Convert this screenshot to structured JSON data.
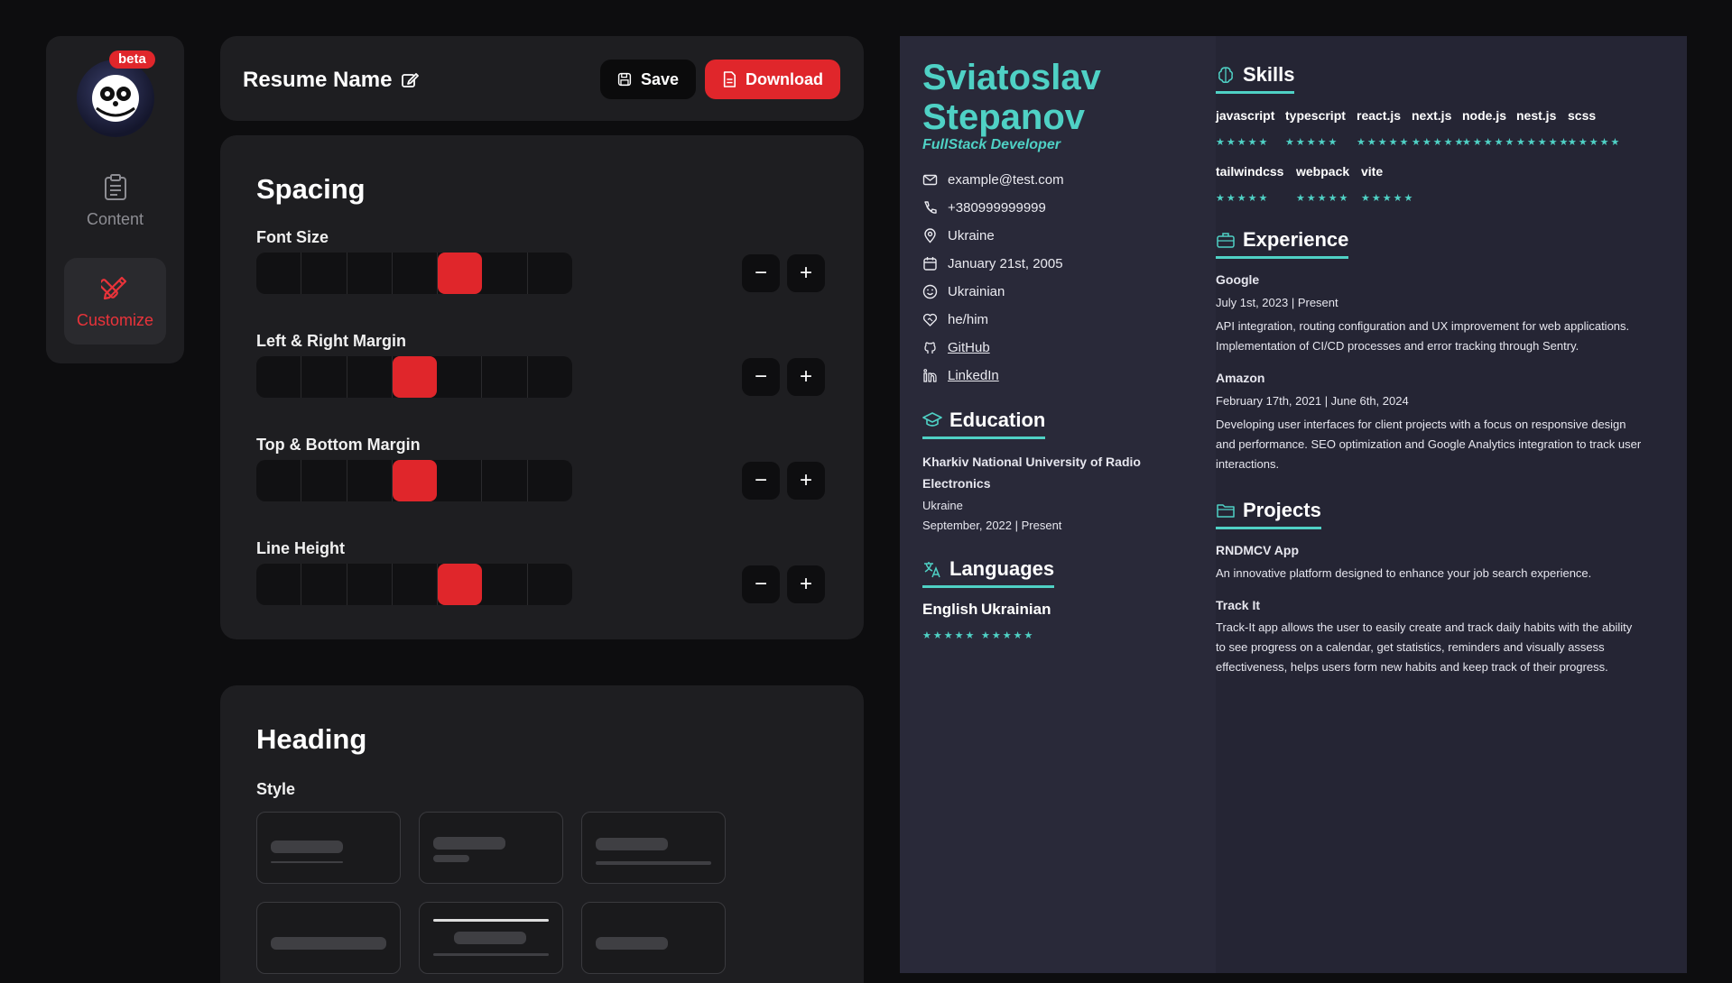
{
  "sidebar": {
    "beta": "beta",
    "items": [
      {
        "label": "Content",
        "icon": "clipboard-icon"
      },
      {
        "label": "Customize",
        "icon": "pencil-ruler-icon"
      }
    ]
  },
  "topbar": {
    "resume_name": "Resume Name",
    "save_label": "Save",
    "download_label": "Download"
  },
  "spacing": {
    "title": "Spacing",
    "controls": [
      {
        "label": "Font Size",
        "level": 5,
        "steps": 7
      },
      {
        "label": "Left & Right Margin",
        "level": 4,
        "steps": 7
      },
      {
        "label": "Top & Bottom Margin",
        "level": 4,
        "steps": 7
      },
      {
        "label": "Line Height",
        "level": 5,
        "steps": 7
      }
    ]
  },
  "heading": {
    "title": "Heading",
    "style_label": "Style"
  },
  "resume": {
    "first_name": "Sviatoslav",
    "last_name": "Stepanov",
    "role": "FullStack Developer",
    "contacts": {
      "email": "example@test.com",
      "phone": "+380999999999",
      "location": "Ukraine",
      "birthday": "January 21st, 2005",
      "nationality": "Ukrainian",
      "pronouns": "he/him",
      "github": "GitHub",
      "linkedin": "LinkedIn"
    },
    "education": {
      "title": "Education",
      "school_line1": "Kharkiv National University of Radio",
      "school_line2": "Electronics",
      "country": "Ukraine",
      "dates": "September, 2022 | Present"
    },
    "languages": {
      "title": "Languages",
      "items": [
        "English",
        "Ukrainian"
      ],
      "stars": "★★★★★"
    },
    "skills": {
      "title": "Skills",
      "items": [
        "javascript",
        "typescript",
        "react.js",
        "next.js",
        "node.js",
        "nest.js",
        "scss",
        "tailwindcss",
        "webpack",
        "vite"
      ],
      "stars": "★★★★★"
    },
    "experience": {
      "title": "Experience",
      "jobs": [
        {
          "company": "Google",
          "dates": "July 1st, 2023 | Present",
          "desc1": "API integration, routing configuration and UX improvement for web applications.",
          "desc2": "Implementation of CI/CD processes and error tracking through Sentry."
        },
        {
          "company": "Amazon",
          "dates": "February 17th, 2021 | June 6th, 2024",
          "desc1": "Developing user interfaces for client projects with a focus on responsive design",
          "desc2": "and performance. SEO optimization and Google Analytics integration to track user",
          "desc3": "interactions."
        }
      ]
    },
    "projects": {
      "title": "Projects",
      "items": [
        {
          "name": "RNDMCV App",
          "desc1": "An innovative platform designed to enhance your job search experience."
        },
        {
          "name": "Track It",
          "desc1": "Track-It app allows the user to easily create and track daily habits with the ability",
          "desc2": "to see progress on a calendar, get statistics, reminders and visually assess",
          "desc3": "effectiveness, helps users form new habits and keep track of their progress."
        }
      ]
    }
  },
  "colors": {
    "accent": "#4fd1c5",
    "brand_red": "#e0262b"
  }
}
